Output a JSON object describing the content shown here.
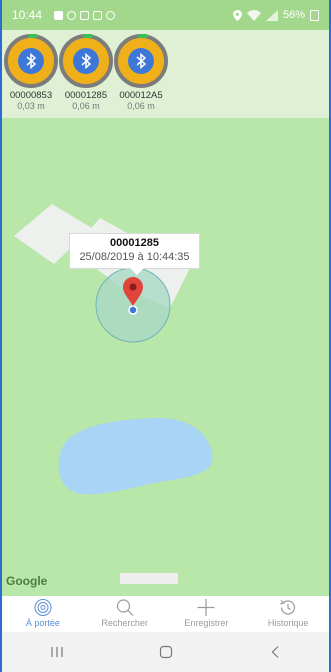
{
  "status": {
    "time": "10:44",
    "battery": "56%"
  },
  "beacons": [
    {
      "id": "00000853",
      "distance": "0,03 m"
    },
    {
      "id": "00001285",
      "distance": "0,06 m"
    },
    {
      "id": "000012A5",
      "distance": "0,06 m"
    }
  ],
  "map": {
    "callout_title": "00001285",
    "callout_subtitle": "25/08/2019 à 10:44:35",
    "attribution": "Google",
    "colors": {
      "land": "#b9e6a9",
      "water": "#a8d4f5",
      "building": "#eef0ee",
      "marker": "#e0443a"
    }
  },
  "tabs": [
    {
      "label": "À portée",
      "icon": "radar-icon",
      "active": true
    },
    {
      "label": "Rechercher",
      "icon": "search-icon",
      "active": false
    },
    {
      "label": "Enregistrer",
      "icon": "plus-icon",
      "active": false
    },
    {
      "label": "Historique",
      "icon": "history-icon",
      "active": false
    }
  ],
  "accent_color": "#5b8ed6"
}
